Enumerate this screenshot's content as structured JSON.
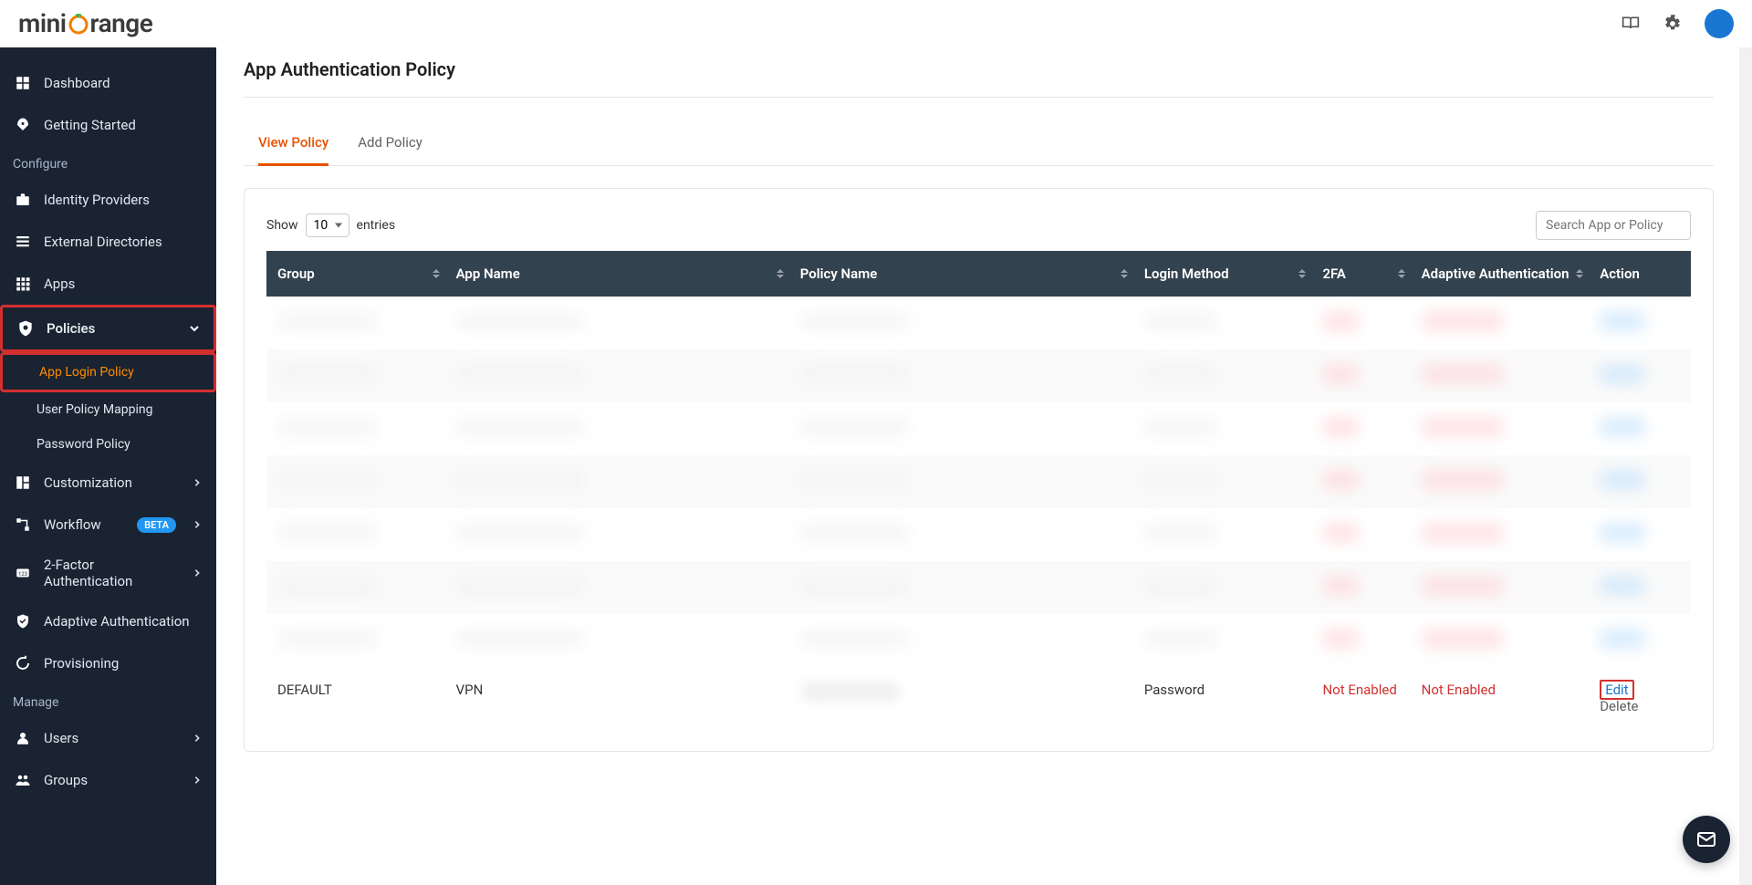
{
  "brand": {
    "part1": "mini",
    "accent_char": "o",
    "part2": "range"
  },
  "header": {
    "icons": [
      "book-icon",
      "gear-icon",
      "avatar"
    ]
  },
  "sidebar": {
    "items": [
      {
        "label": "Dashboard",
        "icon": "dashboard-icon"
      },
      {
        "label": "Getting Started",
        "icon": "rocket-icon"
      }
    ],
    "configure_label": "Configure",
    "configure_items": [
      {
        "label": "Identity Providers",
        "icon": "briefcase-icon"
      },
      {
        "label": "External Directories",
        "icon": "list-icon"
      },
      {
        "label": "Apps",
        "icon": "apps-icon"
      },
      {
        "label": "Policies",
        "icon": "shield-icon",
        "expanded": true,
        "highlight": true
      },
      {
        "label": "Customization",
        "icon": "layout-icon",
        "chevron": true
      },
      {
        "label": "Workflow",
        "icon": "workflow-icon",
        "badge": "BETA",
        "chevron": true
      },
      {
        "label": "2-Factor Authentication",
        "icon": "key-icon",
        "chevron": true
      },
      {
        "label": "Adaptive Authentication",
        "icon": "shield-check-icon"
      },
      {
        "label": "Provisioning",
        "icon": "sync-icon"
      }
    ],
    "policies_sub": [
      {
        "label": "App Login Policy",
        "active": true,
        "highlight": true
      },
      {
        "label": "User Policy Mapping"
      },
      {
        "label": "Password Policy"
      }
    ],
    "manage_label": "Manage",
    "manage_items": [
      {
        "label": "Users",
        "icon": "user-icon",
        "chevron": true
      },
      {
        "label": "Groups",
        "icon": "people-icon",
        "chevron": true
      }
    ]
  },
  "page": {
    "title": "App Authentication Policy",
    "tabs": [
      {
        "label": "View Policy",
        "active": true
      },
      {
        "label": "Add Policy"
      }
    ],
    "entries": {
      "show_label": "Show",
      "value": "10",
      "suffix": "entries"
    },
    "search_placeholder": "Search App or Policy",
    "columns": [
      "Group",
      "App Name",
      "Policy Name",
      "Login Method",
      "2FA",
      "Adaptive Authentication",
      "Action"
    ],
    "blurred_rows": 7,
    "visible_row": {
      "group": "DEFAULT",
      "app_name": "VPN",
      "policy_name": "",
      "login_method": "Password",
      "twofa": "Not Enabled",
      "adaptive": "Not Enabled",
      "action_edit": "Edit",
      "action_delete": "Delete"
    }
  }
}
